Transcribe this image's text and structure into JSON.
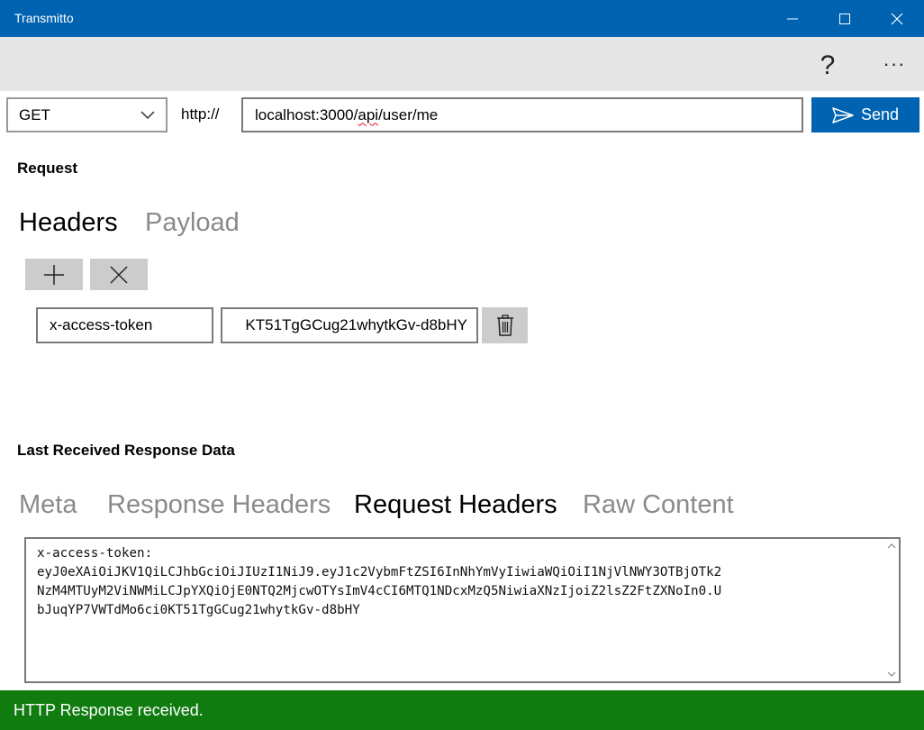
{
  "window": {
    "title": "Transmitto"
  },
  "commandbar": {
    "help_label": "?",
    "more_label": "···"
  },
  "request_line": {
    "method": "GET",
    "scheme": "http://",
    "url_host": "localhost:3000/",
    "url_misspelled": "api",
    "url_rest": "/user/me",
    "send_label": "Send"
  },
  "request": {
    "title": "Request",
    "tabs": [
      {
        "label": "Headers",
        "active": true
      },
      {
        "label": "Payload",
        "active": false
      }
    ],
    "headers": [
      {
        "key": "x-access-token",
        "value_visible": "KT51TgGCug21whytkGv-d8bHY"
      }
    ]
  },
  "response": {
    "title": "Last Received Response Data",
    "tabs": [
      {
        "label": "Meta",
        "active": false
      },
      {
        "label": "Response Headers",
        "active": false
      },
      {
        "label": "Request Headers",
        "active": true
      },
      {
        "label": "Raw Content",
        "active": false
      }
    ],
    "content_lines": [
      "x-access-token:",
      "eyJ0eXAiOiJKV1QiLCJhbGciOiJIUzI1NiJ9.eyJ1c2VybmFtZSI6InNhYmVyIiwiaWQiOiI1NjVlNWY3OTBjOTk2",
      "NzM4MTUyM2ViNWMiLCJpYXQiOjE0NTQ2MjcwOTYsImV4cCI6MTQ1NDcxMzQ5NiwiaXNzIjoiZ2lsZ2FtZXNoIn0.U",
      "bJuqYP7VWTdMo6ci0KT51TgGCug21whytkGv-d8bHY"
    ]
  },
  "status": {
    "text": "HTTP Response received.",
    "color": "#107c10"
  },
  "colors": {
    "accent": "#0063b1",
    "command_bar": "#e6e6e6",
    "button_gray": "#cccccc"
  }
}
